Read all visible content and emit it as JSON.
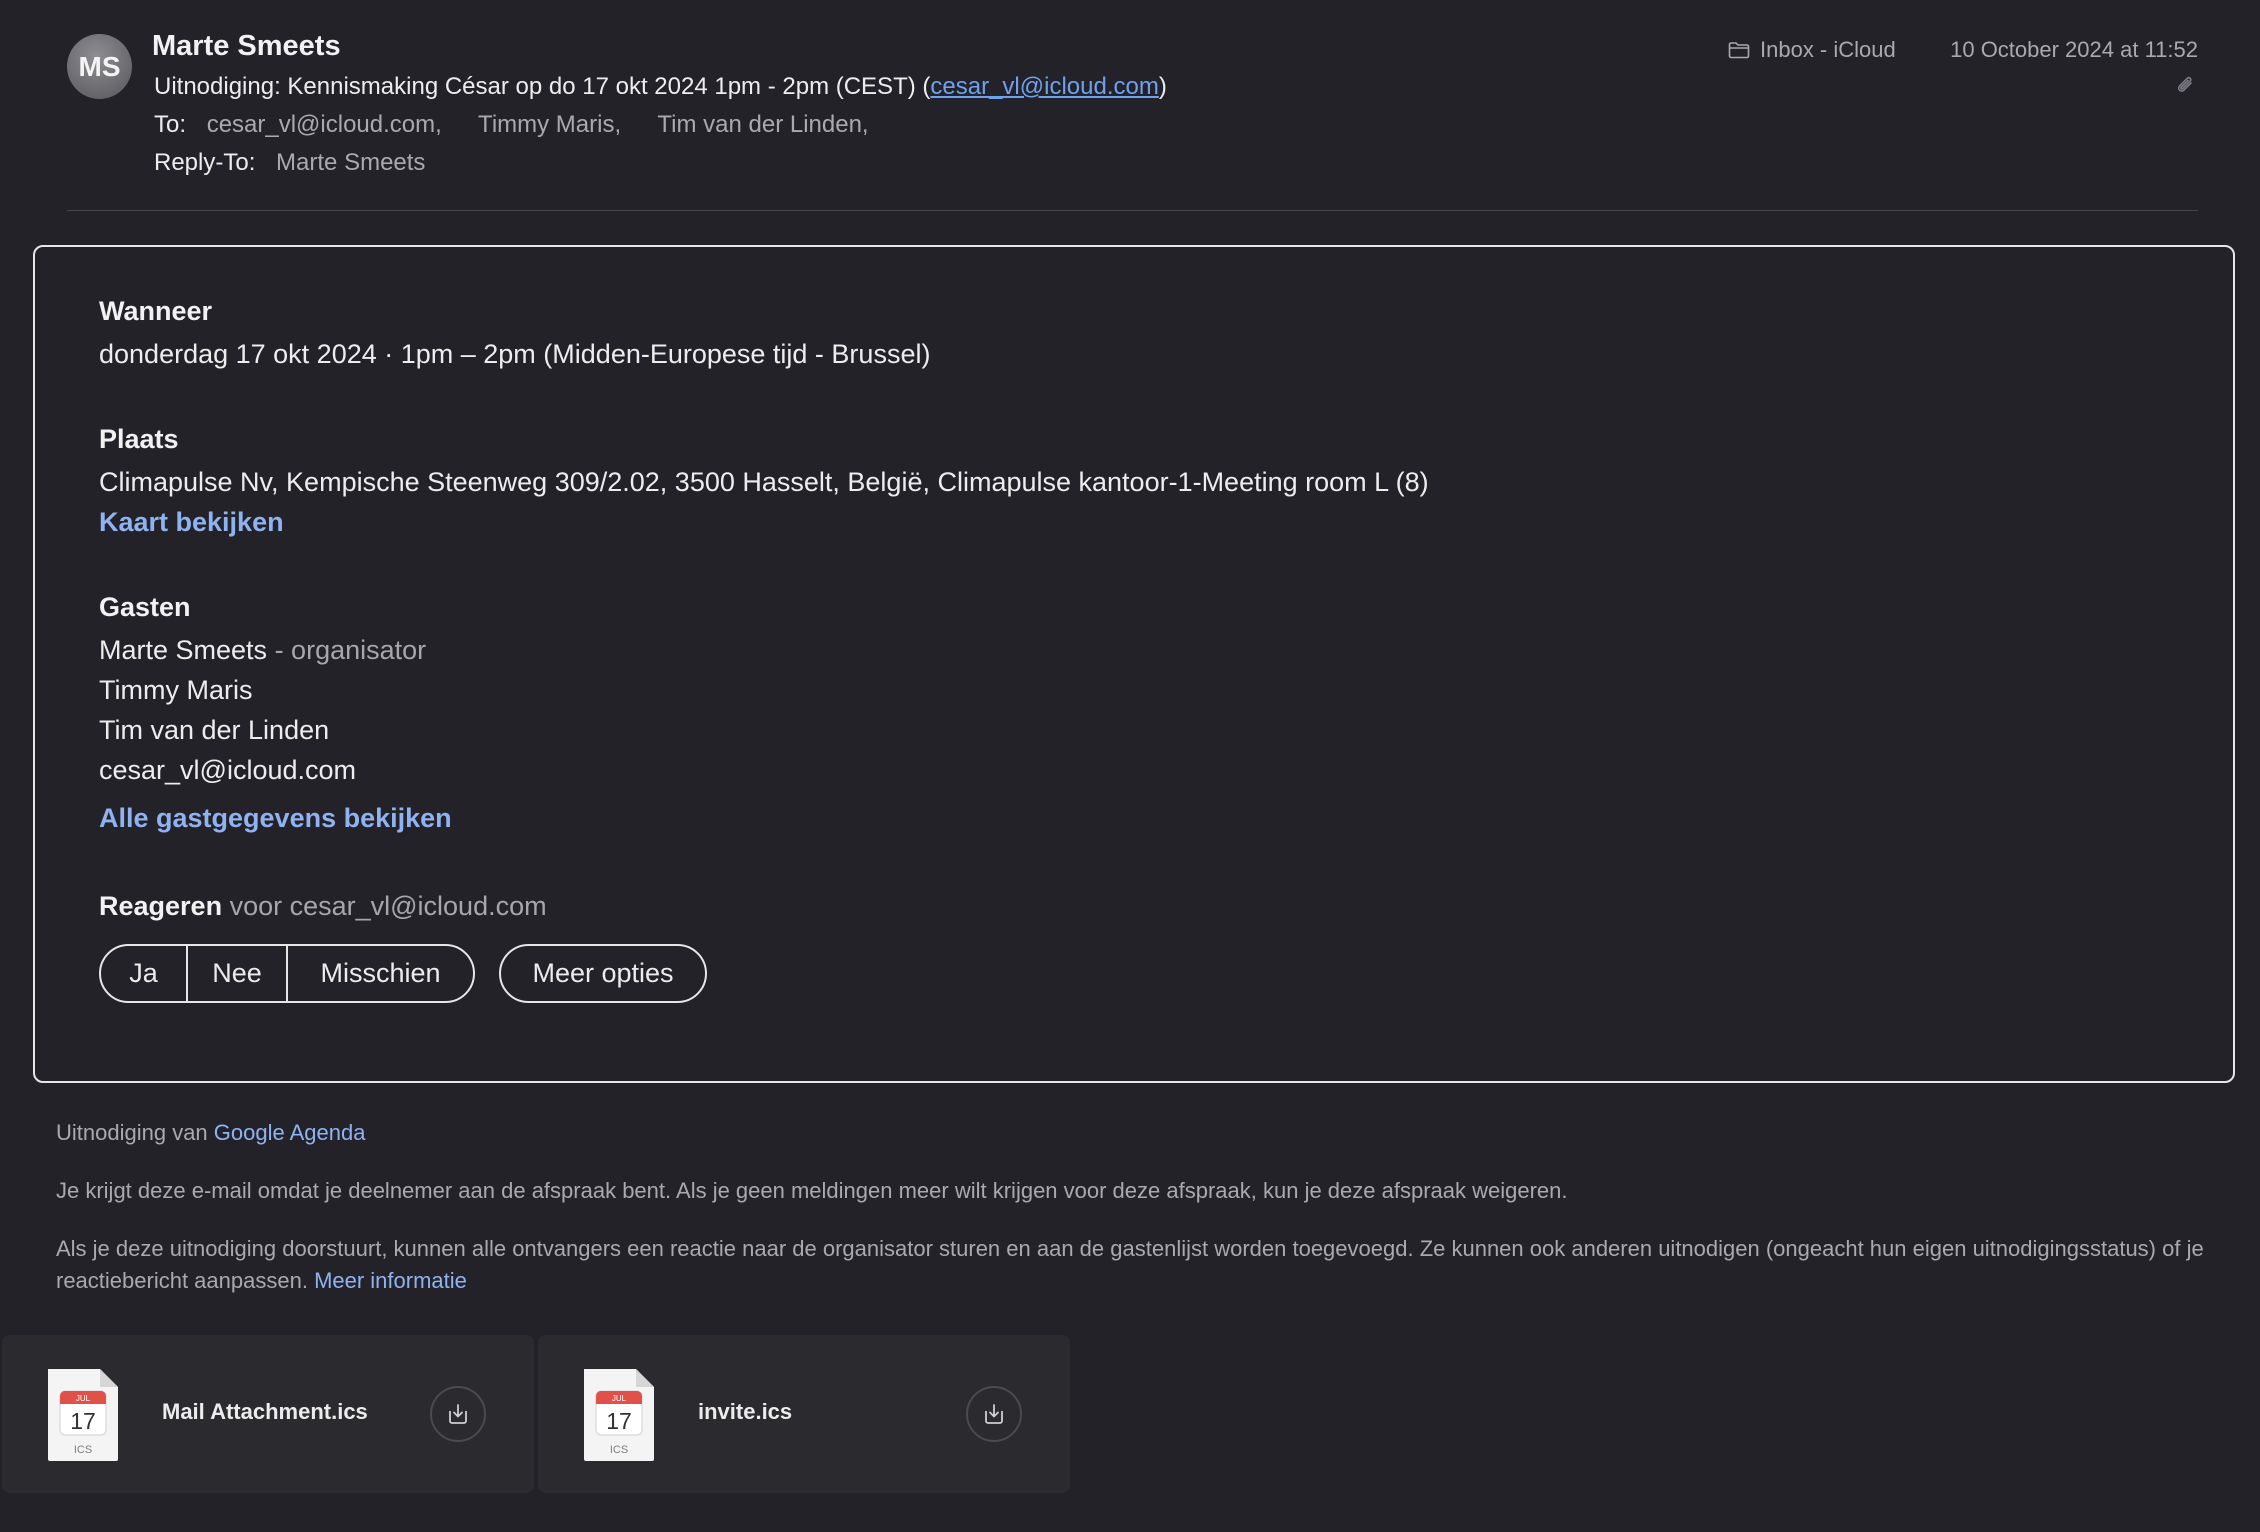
{
  "header": {
    "avatar_initials": "MS",
    "sender": "Marte Smeets",
    "subject_prefix": "Uitnodiging: Kennismaking César op do 17 okt 2024 1pm - 2pm (CEST) (",
    "subject_email": "cesar_vl@icloud.com",
    "subject_suffix": ")",
    "to_label": "To:",
    "to": [
      "cesar_vl@icloud.com,",
      "Timmy Maris,",
      "Tim van der Linden,"
    ],
    "reply_to_label": "Reply-To:",
    "reply_to": "Marte Smeets",
    "mailbox": "Inbox - iCloud",
    "date": "10 October 2024 at 11:52"
  },
  "invite": {
    "when_title": "Wanneer",
    "when_value": "donderdag 17 okt 2024 · 1pm – 2pm (Midden-Europese tijd - Brussel)",
    "where_title": "Plaats",
    "where_value": "Climapulse Nv, Kempische Steenweg 309/2.02, 3500 Hasselt, België, Climapulse kantoor-1-Meeting room L (8)",
    "map_link": "Kaart bekijken",
    "guests_title": "Gasten",
    "guests": [
      {
        "name": "Marte Smeets",
        "role": " - organisator"
      },
      {
        "name": "Timmy Maris",
        "role": ""
      },
      {
        "name": "Tim van der Linden",
        "role": ""
      },
      {
        "name": "cesar_vl@icloud.com",
        "role": ""
      }
    ],
    "all_guests_link": "Alle gastgegevens bekijken",
    "rsvp_title": "Reageren",
    "rsvp_for": " voor cesar_vl@icloud.com",
    "rsvp_options": [
      "Ja",
      "Nee",
      "Misschien"
    ],
    "more_options": "Meer opties"
  },
  "footer": {
    "invite_from": "Uitnodiging van ",
    "invite_from_link": "Google Agenda",
    "notice": "Je krijgt deze e-mail omdat je deelnemer aan de afspraak bent. Als je geen meldingen meer wilt krijgen voor deze afspraak, kun je deze afspraak weigeren.",
    "forward_notice": "Als je deze uitnodiging doorstuurt, kunnen alle ontvangers een reactie naar de organisator sturen en aan de gastenlijst worden toegevoegd. Ze kunnen ook anderen uitnodigen (ongeacht hun eigen uitnodigingsstatus) of je reactiebericht aanpassen. ",
    "more_info_link": "Meer informatie"
  },
  "attachments": [
    {
      "name": "Mail Attachment.ics",
      "icon_month": "JUL",
      "icon_day": "17",
      "icon_ext": "ICS"
    },
    {
      "name": "invite.ics",
      "icon_month": "JUL",
      "icon_day": "17",
      "icon_ext": "ICS"
    }
  ],
  "colors": {
    "background": "#242229",
    "link": "#8fb3f0",
    "subject_link": "#6ea1ee",
    "calendar_red": "#e0514a"
  }
}
